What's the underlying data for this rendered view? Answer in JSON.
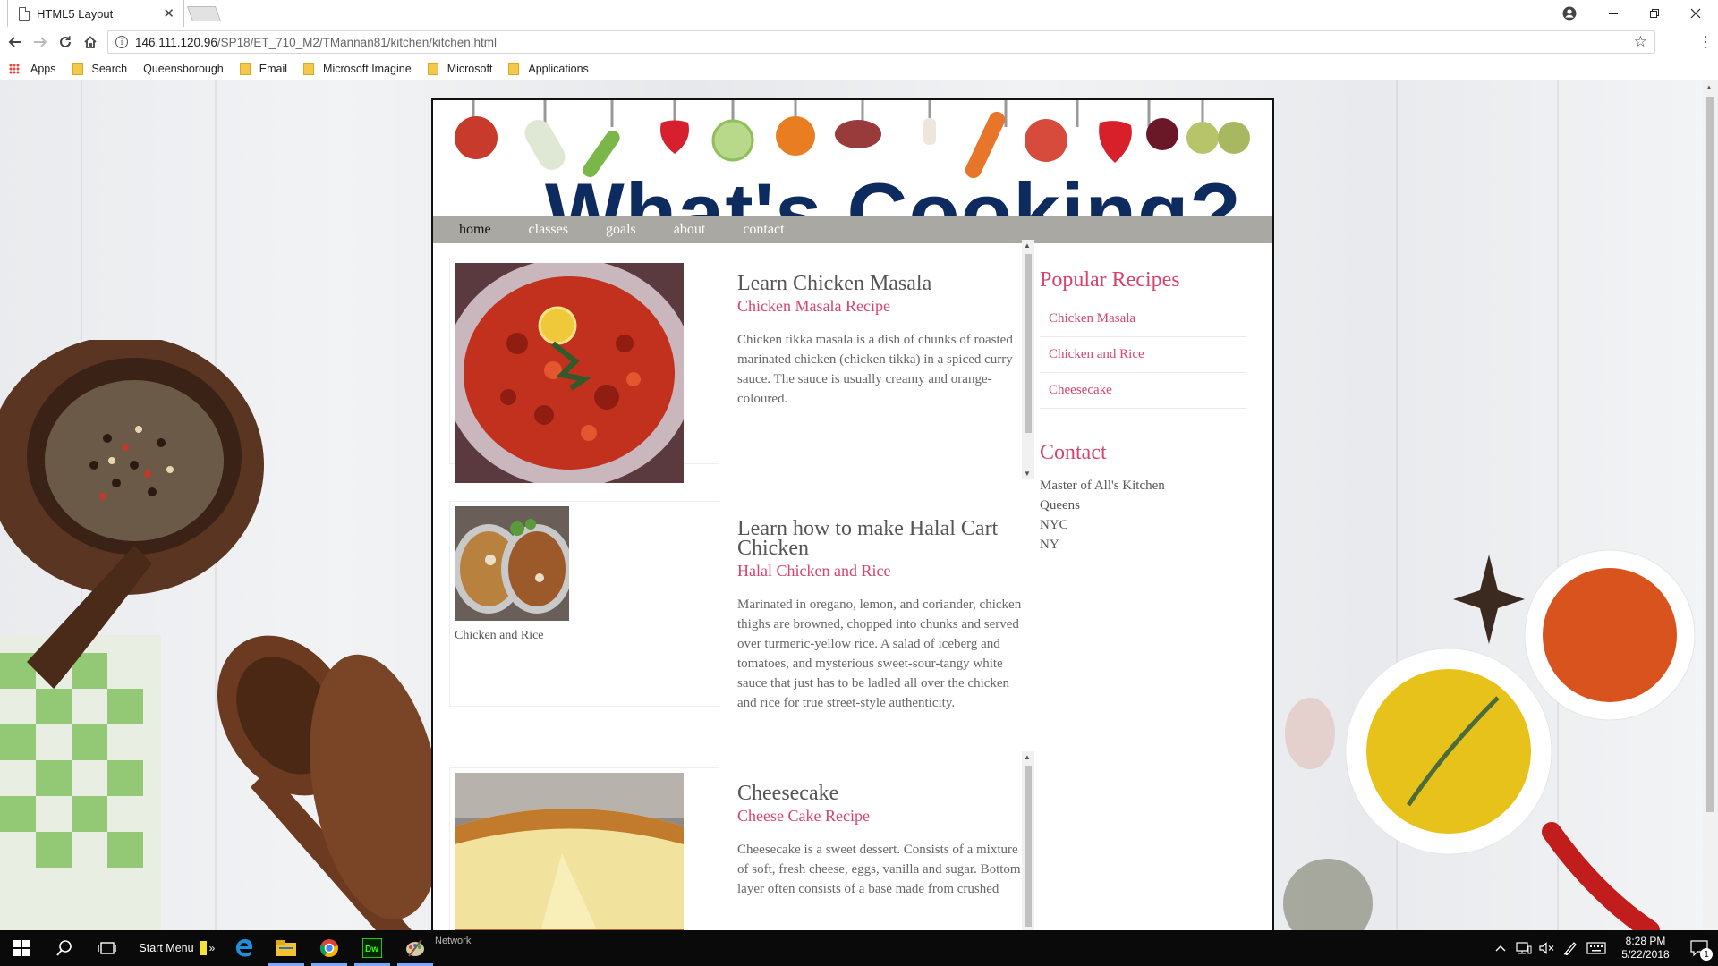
{
  "browser": {
    "tab_title": "HTML5 Layout",
    "tab_close": "✕",
    "url_host": "146.111.120.96",
    "url_path": "/SP18/ET_710_M2/TMannan81/kitchen/kitchen.html",
    "bookmarks": [
      "Apps",
      "Search",
      "Queensborough",
      "Email",
      "Microsoft Imagine",
      "Microsoft",
      "Applications"
    ]
  },
  "site": {
    "banner_title": "What's Cooking?",
    "nav": [
      "home",
      "classes",
      "goals",
      "about",
      "contact"
    ],
    "articles": [
      {
        "title": "Learn Chicken Masala",
        "subtitle": "Chicken Masala Recipe",
        "body": "Chicken tikka masala is a dish of chunks of roasted marinated chicken (chicken tikka) in a spiced curry sauce. The sauce is usually creamy and orange-coloured.",
        "caption": ""
      },
      {
        "title": "Learn how to make Halal Cart Chicken",
        "subtitle": "Halal Chicken and Rice",
        "body": "Marinated in oregano, lemon, and coriander, chicken thighs are browned, chopped into chunks and served over turmeric-yellow rice. A salad of iceberg and tomatoes, and mysterious sweet-sour-tangy white sauce that just has to be ladled all over the chicken and rice for true street-style authenticity.",
        "caption": "Chicken and Rice"
      },
      {
        "title": "Cheesecake",
        "subtitle": "Cheese Cake Recipe",
        "body": "Cheesecake is a sweet dessert. Consists of a mixture of soft, fresh cheese, eggs, vanilla and sugar. Bottom layer often consists of a base made from crushed",
        "caption": ""
      }
    ],
    "sidebar": {
      "popular_title": "Popular Recipes",
      "popular_items": [
        "Chicken Masala",
        "Chicken and Rice",
        "Cheesecake"
      ],
      "contact_title": "Contact",
      "contact_lines": [
        "Master of All's Kitchen",
        "Queens",
        "NYC",
        "NY"
      ]
    }
  },
  "taskbar": {
    "start_menu_label": "Start Menu",
    "network_label": "Network",
    "time": "8:28 PM",
    "date": "5/22/2018",
    "notification_count": "1"
  },
  "colors": {
    "accent_pink": "#d6436c",
    "navbar_gray": "#a9a8a3",
    "banner_navy": "#0d2b5e"
  }
}
